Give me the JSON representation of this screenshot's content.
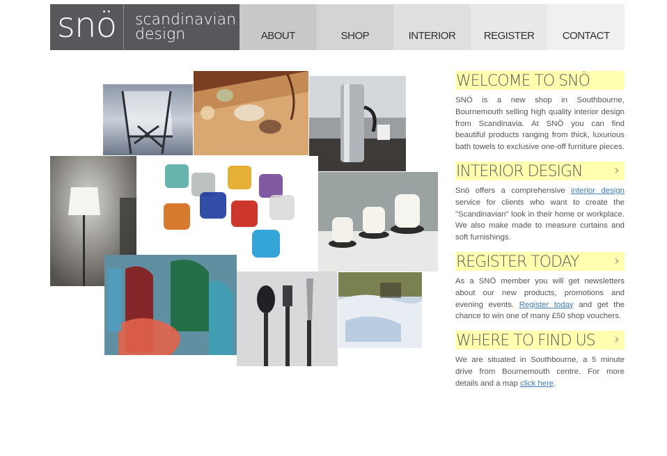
{
  "header": {
    "logo_text": "snö",
    "tagline_line1": "scandinavian",
    "tagline_line2": "design"
  },
  "nav": {
    "items": [
      {
        "label": "ABOUT"
      },
      {
        "label": "SHOP"
      },
      {
        "label": "INTERIOR"
      },
      {
        "label": "REGISTER"
      },
      {
        "label": "CONTACT"
      }
    ]
  },
  "sections": {
    "welcome": {
      "title": "WELCOME TO SNÖ",
      "text": "SNÖ is a new shop in Southbourne, Bournemouth selling high quality interior design from Scandinavia. At SNÖ you can find beautiful products ranging from thick, luxurious bath towels to exclusive one-off furniture pieces."
    },
    "interior": {
      "title": "INTERIOR DESIGN",
      "text_before": "Snö offers a comprehensive ",
      "link": "interior design",
      "text_after": " service for clients who want to create the \"Scandinavian\" look in their home or workplace. We also make made to measure curtains and soft furnishings."
    },
    "register": {
      "title": "REGISTER TODAY",
      "text_before": "As a SNÖ member you will get newsletters about our new products, promotions and evening events. ",
      "link": "Register today",
      "text_after": " and get the chance to win one of many £50 shop vouchers."
    },
    "find": {
      "title": "WHERE TO FIND US",
      "text_before": "We are situated in Southbourne, a 5 minute drive from Bournemouth centre. For more details and a map ",
      "link": "click here",
      "text_after": "."
    }
  },
  "icons": {
    "chevron": "chevron-right-icon"
  }
}
